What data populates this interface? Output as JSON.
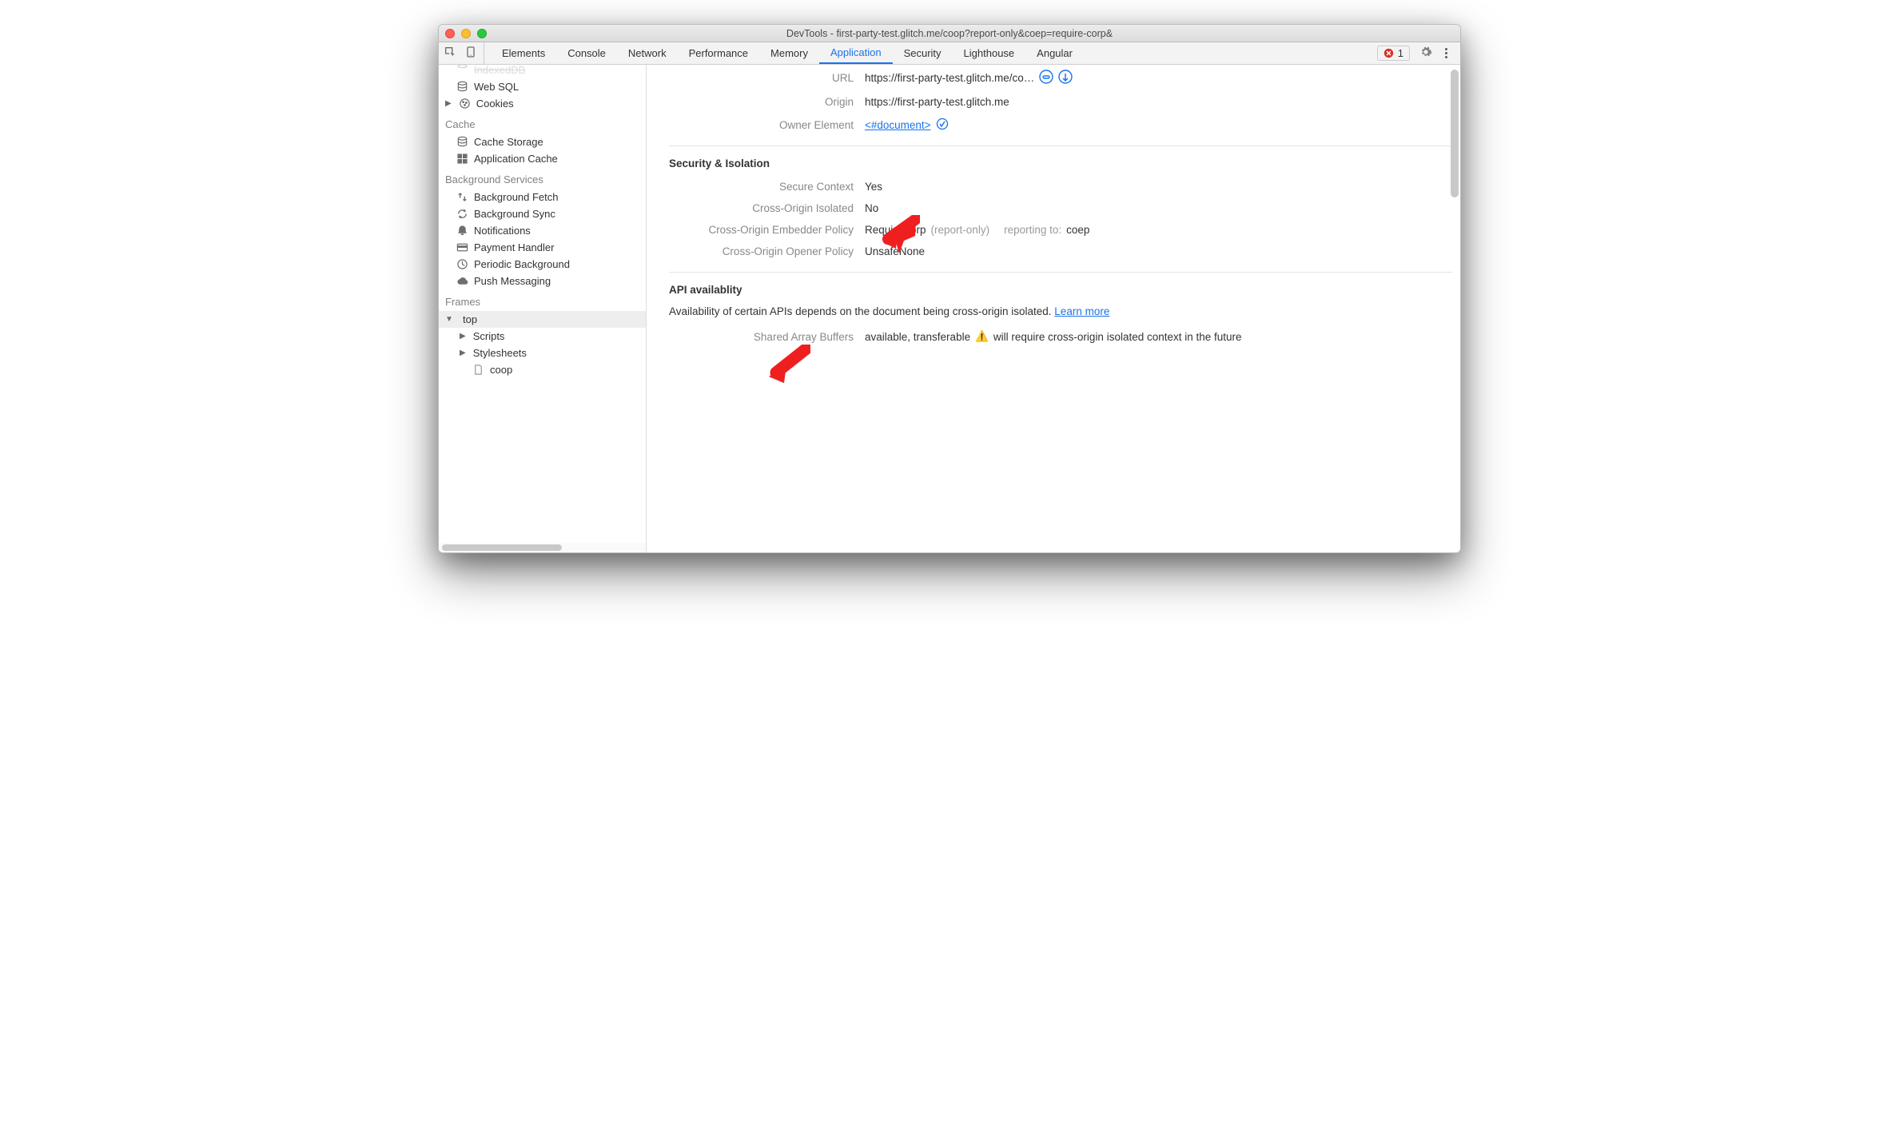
{
  "window": {
    "title": "DevTools - first-party-test.glitch.me/coop?report-only&coep=require-corp&"
  },
  "tabs": {
    "items": [
      "Elements",
      "Console",
      "Network",
      "Performance",
      "Memory",
      "Application",
      "Security",
      "Lighthouse",
      "Angular"
    ],
    "active": "Application",
    "error_count": "1"
  },
  "sidebar": {
    "storage": {
      "indexeddb": "IndexedDB",
      "websql": "Web SQL",
      "cookies": "Cookies"
    },
    "cache": {
      "heading": "Cache",
      "items": [
        "Cache Storage",
        "Application Cache"
      ]
    },
    "bg": {
      "heading": "Background Services",
      "items": [
        "Background Fetch",
        "Background Sync",
        "Notifications",
        "Payment Handler",
        "Periodic Background",
        "Push Messaging"
      ]
    },
    "frames": {
      "heading": "Frames",
      "top": "top",
      "children": [
        "Scripts",
        "Stylesheets"
      ],
      "leaf": "coop"
    }
  },
  "details": {
    "url_label": "URL",
    "url_value": "https://first-party-test.glitch.me/co…",
    "origin_label": "Origin",
    "origin_value": "https://first-party-test.glitch.me",
    "owner_label": "Owner Element",
    "owner_value": "<#document>",
    "sec_heading": "Security & Isolation",
    "secure_ctx_label": "Secure Context",
    "secure_ctx_value": "Yes",
    "coi_label": "Cross-Origin Isolated",
    "coi_value": "No",
    "coep_label": "Cross-Origin Embedder Policy",
    "coep_value": "RequireCorp",
    "coep_paren": "(report-only)",
    "coep_report_label": "reporting to:",
    "coep_report_value": "coep",
    "coop_label": "Cross-Origin Opener Policy",
    "coop_value": "UnsafeNone",
    "api_heading": "API availablity",
    "api_desc": "Availability of certain APIs depends on the document being cross-origin isolated. ",
    "api_learn": "Learn more",
    "sab_label": "Shared Array Buffers",
    "sab_value": "available, transferable",
    "sab_warn": "⚠️",
    "sab_warn_text": "will require cross-origin isolated context in the future"
  }
}
